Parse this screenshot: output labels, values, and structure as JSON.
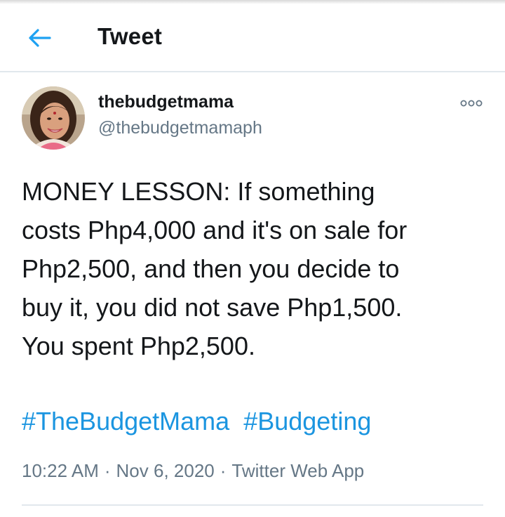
{
  "header": {
    "title": "Tweet"
  },
  "author": {
    "display_name": "thebudgetmama",
    "handle": "@thebudgetmamaph"
  },
  "tweet": {
    "lines": [
      "MONEY LESSON: If something",
      "costs Php4,000 and it's on sale for",
      "Php2,500, and then you decide to",
      "buy it, you did not save Php1,500.",
      "You spent Php2,500."
    ],
    "hashtags": [
      "#TheBudgetMama",
      "#Budgeting"
    ]
  },
  "meta": {
    "time": "10:22 AM",
    "date": "Nov 6, 2020",
    "source": "Twitter Web App",
    "separator": "·"
  },
  "icons": {
    "back": "arrow-left-icon",
    "more": "more-options-icon"
  },
  "colors": {
    "accent": "#1b95e0",
    "text": "#14171a",
    "secondary": "#657786",
    "border": "#e1e8ed"
  }
}
